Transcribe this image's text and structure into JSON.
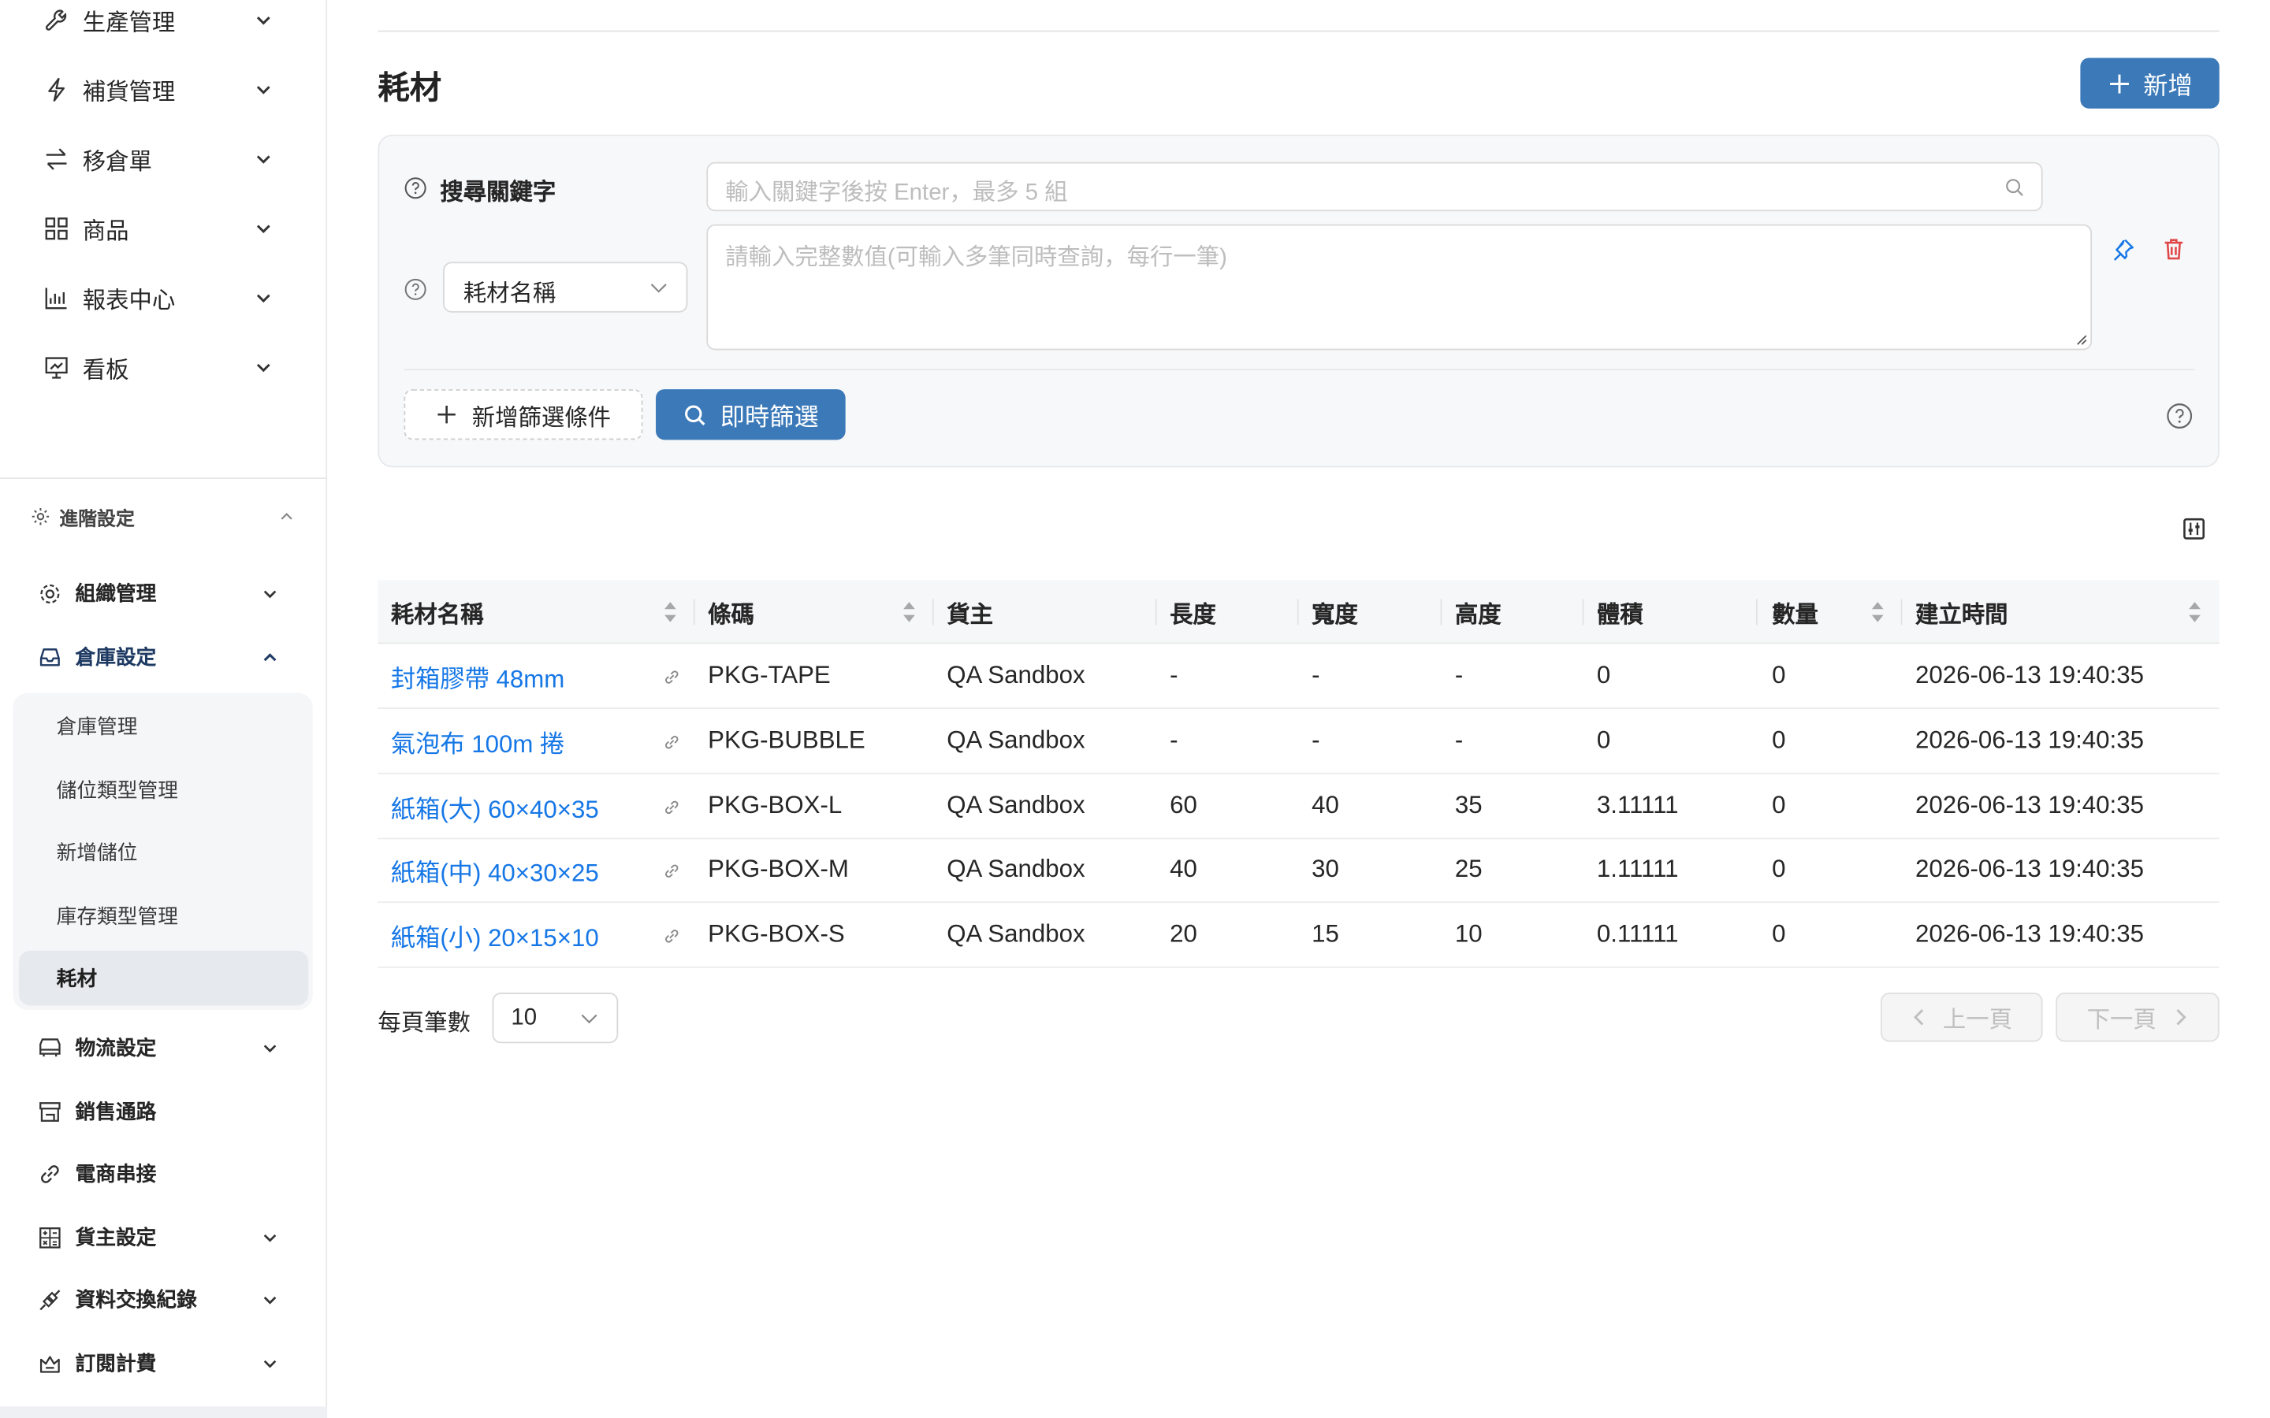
{
  "sidebar": {
    "top_items": [
      {
        "label": "生產管理",
        "icon": "wrench-icon"
      },
      {
        "label": "補貨管理",
        "icon": "lightning-icon"
      },
      {
        "label": "移倉單",
        "icon": "swap-icon"
      },
      {
        "label": "商品",
        "icon": "grid-icon"
      },
      {
        "label": "報表中心",
        "icon": "bar-chart-icon"
      },
      {
        "label": "看板",
        "icon": "dashboard-icon"
      }
    ],
    "section": {
      "label": "進階設定",
      "icon": "gear-icon"
    },
    "sub_items": [
      {
        "label": "組織管理",
        "icon": "gear-icon"
      },
      {
        "label": "倉庫設定",
        "icon": "inbox-icon"
      },
      {
        "label": "物流設定",
        "icon": "truck-icon"
      },
      {
        "label": "銷售通路",
        "icon": "shop-icon"
      },
      {
        "label": "電商串接",
        "icon": "link-icon"
      },
      {
        "label": "貨主設定",
        "icon": "calculator-icon"
      },
      {
        "label": "資料交換紀錄",
        "icon": "api-icon"
      },
      {
        "label": "訂閱計費",
        "icon": "crown-icon"
      }
    ],
    "warehouse_children": [
      {
        "label": "倉庫管理"
      },
      {
        "label": "儲位類型管理"
      },
      {
        "label": "新增儲位"
      },
      {
        "label": "庫存類型管理"
      },
      {
        "label": "耗材",
        "active": true
      }
    ]
  },
  "page": {
    "title": "耗材",
    "add_button": "新增"
  },
  "filter": {
    "keyword_label": "搜尋關鍵字",
    "keyword_placeholder": "輸入關鍵字後按 Enter，最多 5 組",
    "field_select": "耗材名稱",
    "values_placeholder": "請輸入完整數值(可輸入多筆同時查詢，每行一筆)",
    "add_condition": "新增篩選條件",
    "apply": "即時篩選"
  },
  "table": {
    "columns": [
      "耗材名稱",
      "條碼",
      "貨主",
      "長度",
      "寬度",
      "高度",
      "體積",
      "數量",
      "建立時間"
    ],
    "rows": [
      {
        "name": "封箱膠帶 48mm",
        "barcode": "PKG-TAPE",
        "owner": "QA Sandbox",
        "length": "-",
        "width": "-",
        "height": "-",
        "volume": "0",
        "qty": "0",
        "created": "2026-06-13 19:40:35"
      },
      {
        "name": "氣泡布 100m 捲",
        "barcode": "PKG-BUBBLE",
        "owner": "QA Sandbox",
        "length": "-",
        "width": "-",
        "height": "-",
        "volume": "0",
        "qty": "0",
        "created": "2026-06-13 19:40:35"
      },
      {
        "name": "紙箱(大) 60×40×35",
        "barcode": "PKG-BOX-L",
        "owner": "QA Sandbox",
        "length": "60",
        "width": "40",
        "height": "35",
        "volume": "3.11111",
        "qty": "0",
        "created": "2026-06-13 19:40:35"
      },
      {
        "name": "紙箱(中) 40×30×25",
        "barcode": "PKG-BOX-M",
        "owner": "QA Sandbox",
        "length": "40",
        "width": "30",
        "height": "25",
        "volume": "1.11111",
        "qty": "0",
        "created": "2026-06-13 19:40:35"
      },
      {
        "name": "紙箱(小) 20×15×10",
        "barcode": "PKG-BOX-S",
        "owner": "QA Sandbox",
        "length": "20",
        "width": "15",
        "height": "10",
        "volume": "0.11111",
        "qty": "0",
        "created": "2026-06-13 19:40:35"
      }
    ]
  },
  "pagination": {
    "page_size_label": "每頁筆數",
    "page_size": "10",
    "prev": "上一頁",
    "next": "下一頁"
  },
  "colors": {
    "primary": "#3b79b8",
    "link": "#1677e6",
    "danger": "#e04848"
  }
}
